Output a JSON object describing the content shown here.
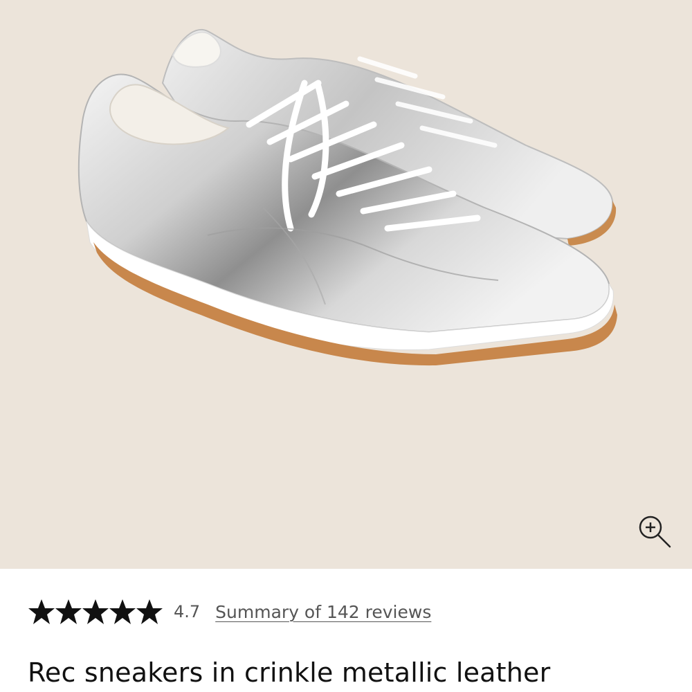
{
  "product": {
    "image_alt": "Silver crinkle metallic leather sneakers with white laces and gum sole",
    "background_color": "#ece4da",
    "zoom_icon": "zoom-in-icon",
    "title": "Rec sneakers in crinkle metallic leather"
  },
  "reviews": {
    "stars_total": 5,
    "rating_value": "4.7",
    "summary_link": "Summary of 142 reviews"
  },
  "colors": {
    "star": "#111111",
    "meta_text": "#555555",
    "title_text": "#111111"
  }
}
